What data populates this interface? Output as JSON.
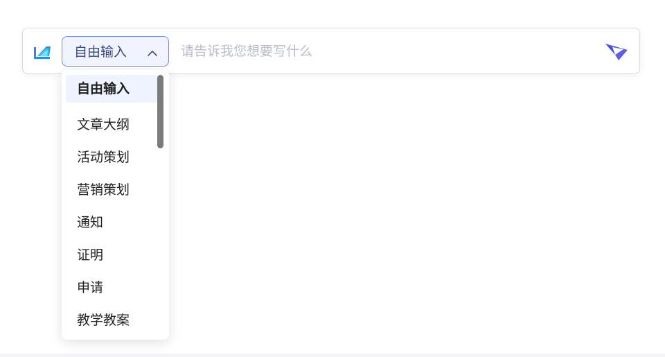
{
  "input_bar": {
    "logo_icon": "document-pen-icon",
    "mode_select": {
      "selected_label": "自由输入",
      "chevron_icon": "chevron-up-icon",
      "expanded": true
    },
    "prompt": {
      "value": "",
      "placeholder": "请告诉我您想要写什么"
    },
    "send_icon": "paper-plane-icon"
  },
  "dropdown": {
    "selected_index": 0,
    "items": [
      {
        "label": "自由输入"
      },
      {
        "label": "文章大纲"
      },
      {
        "label": "活动策划"
      },
      {
        "label": "营销策划"
      },
      {
        "label": "通知"
      },
      {
        "label": "证明"
      },
      {
        "label": "申请"
      },
      {
        "label": "教学教案"
      }
    ]
  },
  "colors": {
    "accent": "#5b5ee8",
    "select_border": "#6f86ea",
    "select_bg": "#f1f4ff",
    "selected_item_bg": "#eef3ff",
    "logo_blue": "#2e86f0",
    "logo_cyan": "#35c6e8"
  }
}
